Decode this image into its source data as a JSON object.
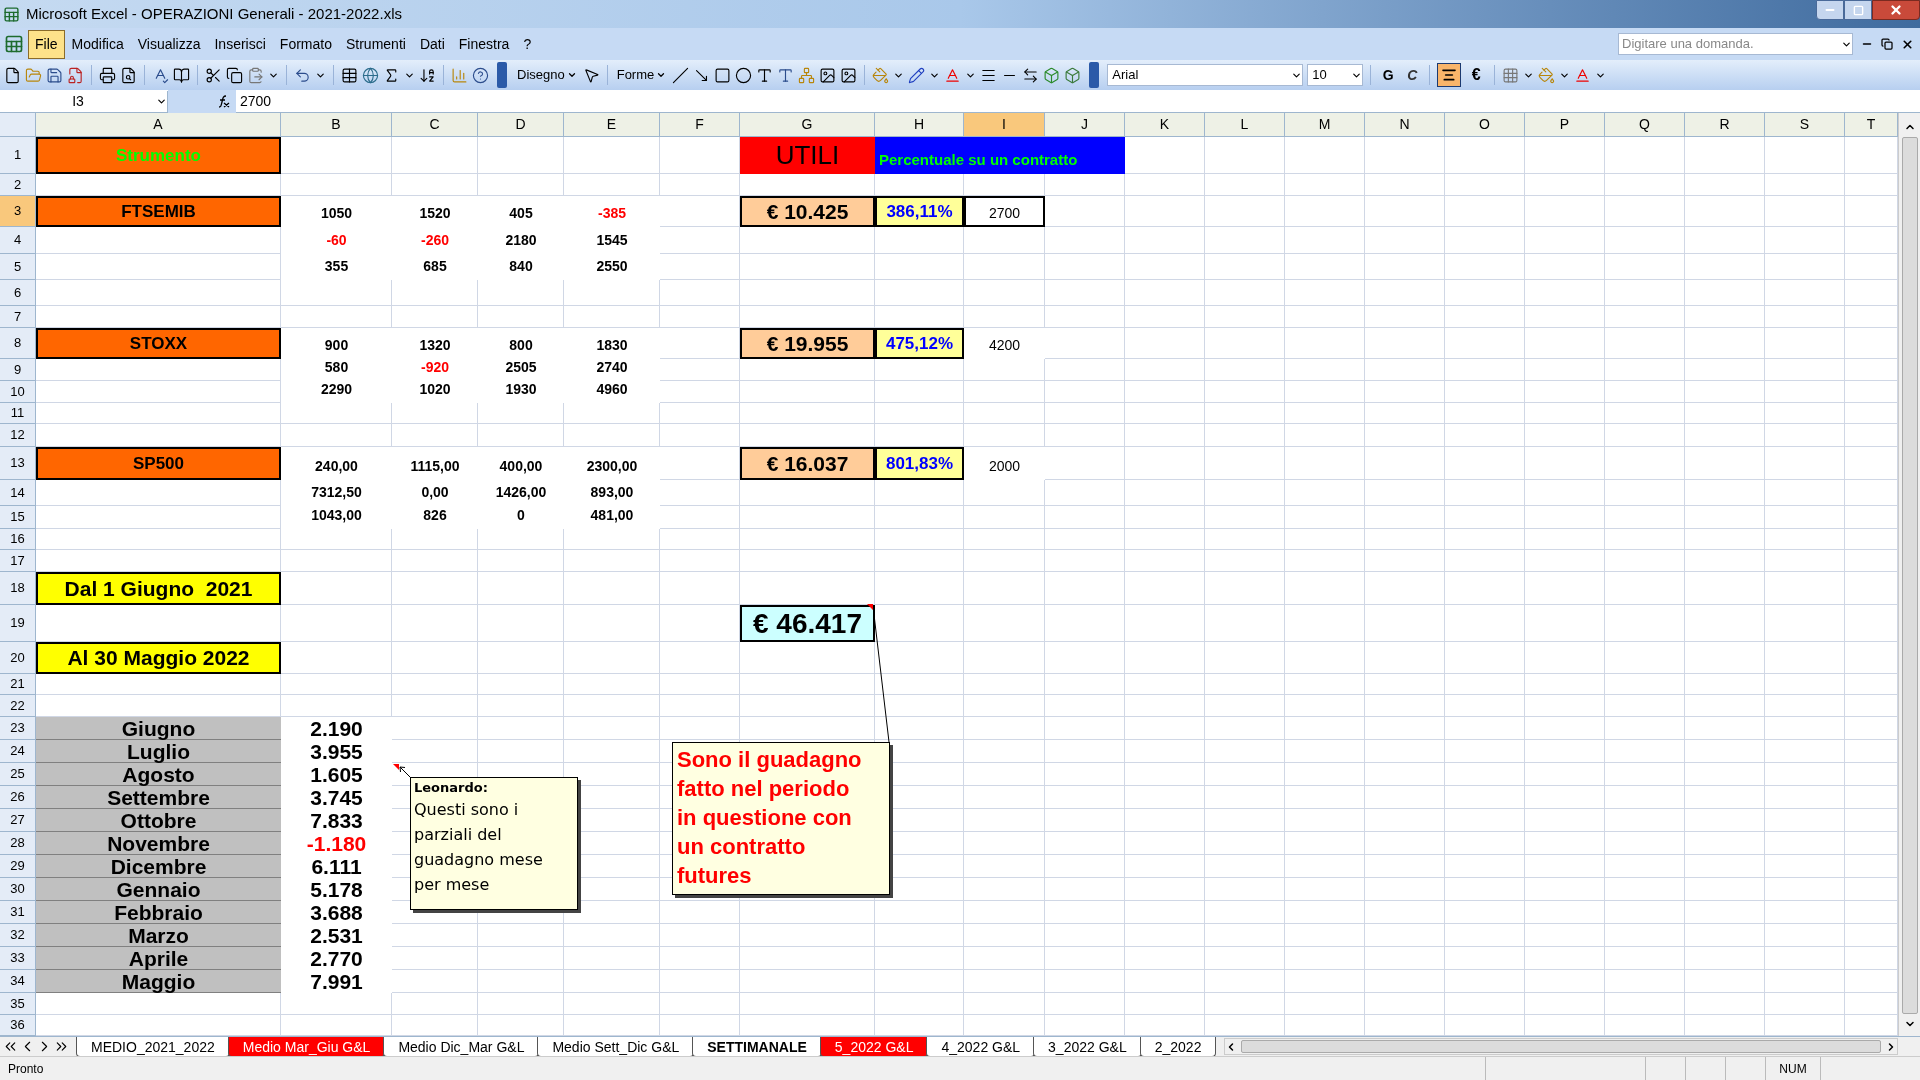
{
  "window": {
    "title": "Microsoft Excel - OPERAZIONI Generali - 2021-2022.xls"
  },
  "menu": [
    {
      "label": "File",
      "selected": true
    },
    {
      "label": "Modifica",
      "selected": false
    },
    {
      "label": "Visualizza",
      "selected": false
    },
    {
      "label": "Inserisci",
      "selected": false
    },
    {
      "label": "Formato",
      "selected": false
    },
    {
      "label": "Strumenti",
      "selected": false
    },
    {
      "label": "Dati",
      "selected": false
    },
    {
      "label": "Finestra",
      "selected": false
    },
    {
      "label": "?",
      "selected": false
    }
  ],
  "help_search": {
    "placeholder": "Digitare una domanda."
  },
  "toolbar": {
    "drawing_menu": "Disegno",
    "shapes_menu": "Forme",
    "font": "Arial",
    "font_size": "10",
    "bold": "G",
    "italic": "C",
    "euro": "€",
    "center_aligned": true
  },
  "formula_bar": {
    "name_box": "I3",
    "value": "2700"
  },
  "columns": [
    {
      "label": "A",
      "selected": false
    },
    {
      "label": "B",
      "selected": false
    },
    {
      "label": "C",
      "selected": false
    },
    {
      "label": "D",
      "selected": false
    },
    {
      "label": "E",
      "selected": false
    },
    {
      "label": "F",
      "selected": false
    },
    {
      "label": "G",
      "selected": false
    },
    {
      "label": "H",
      "selected": false
    },
    {
      "label": "I",
      "selected": true
    },
    {
      "label": "J",
      "selected": false
    },
    {
      "label": "K",
      "selected": false
    },
    {
      "label": "L",
      "selected": false
    },
    {
      "label": "M",
      "selected": false
    },
    {
      "label": "N",
      "selected": false
    },
    {
      "label": "O",
      "selected": false
    },
    {
      "label": "P",
      "selected": false
    },
    {
      "label": "Q",
      "selected": false
    },
    {
      "label": "R",
      "selected": false
    },
    {
      "label": "S",
      "selected": false
    },
    {
      "label": "T",
      "selected": false
    }
  ],
  "rows": [
    {
      "number": "1",
      "selected": false,
      "cells": [
        {
          "kind": "header",
          "text": "Strumento"
        },
        {
          "kind": "blank"
        },
        {
          "kind": "blank"
        },
        {
          "kind": "blank"
        },
        {
          "kind": "blank"
        },
        {
          "kind": "blank"
        },
        {
          "kind": "utili",
          "text": "UTILI"
        },
        {
          "kind": "percent-header",
          "text": "Percentuale su un contratto"
        }
      ]
    },
    {
      "number": "2",
      "selected": false
    },
    {
      "number": "3",
      "selected": true,
      "cells": [
        {
          "kind": "instrument",
          "text": "FTSEMIB"
        },
        {
          "kind": "value",
          "text": "1050"
        },
        {
          "kind": "value",
          "text": "1520"
        },
        {
          "kind": "value",
          "text": "405"
        },
        {
          "kind": "negative",
          "text": "-385"
        },
        {
          "kind": "blank"
        },
        {
          "kind": "total",
          "text": "€ 10.425"
        },
        {
          "kind": "percent",
          "text": "386,11%"
        },
        {
          "kind": "plain",
          "text": "2700"
        }
      ]
    },
    {
      "number": "4",
      "selected": false,
      "cells": [
        {
          "kind": "blank"
        },
        {
          "kind": "negative",
          "text": "-60"
        },
        {
          "kind": "negative",
          "text": "-260"
        },
        {
          "kind": "value",
          "text": "2180"
        },
        {
          "kind": "value",
          "text": "1545"
        }
      ]
    },
    {
      "number": "5",
      "selected": false,
      "cells": [
        {
          "kind": "blank"
        },
        {
          "kind": "value",
          "text": "355"
        },
        {
          "kind": "value",
          "text": "685"
        },
        {
          "kind": "value",
          "text": "840"
        },
        {
          "kind": "value",
          "text": "2550"
        }
      ]
    },
    {
      "number": "6",
      "selected": false
    },
    {
      "number": "7",
      "selected": false
    },
    {
      "number": "8",
      "selected": false,
      "cells": [
        {
          "kind": "instrument",
          "text": "STOXX"
        },
        {
          "kind": "value",
          "text": "900"
        },
        {
          "kind": "value",
          "text": "1320"
        },
        {
          "kind": "value",
          "text": "800"
        },
        {
          "kind": "value",
          "text": "1830"
        },
        {
          "kind": "blank"
        },
        {
          "kind": "total",
          "text": "€ 19.955"
        },
        {
          "kind": "percent",
          "text": "475,12%"
        },
        {
          "kind": "plain",
          "text": "4200"
        }
      ]
    },
    {
      "number": "9",
      "selected": false,
      "cells": [
        {
          "kind": "blank"
        },
        {
          "kind": "value",
          "text": "580"
        },
        {
          "kind": "negative",
          "text": "-920"
        },
        {
          "kind": "value",
          "text": "2505"
        },
        {
          "kind": "value",
          "text": "2740"
        }
      ]
    },
    {
      "number": "10",
      "selected": false,
      "cells": [
        {
          "kind": "blank"
        },
        {
          "kind": "value",
          "text": "2290"
        },
        {
          "kind": "value",
          "text": "1020"
        },
        {
          "kind": "value",
          "text": "1930"
        },
        {
          "kind": "value",
          "text": "4960"
        }
      ]
    },
    {
      "number": "11",
      "selected": false
    },
    {
      "number": "12",
      "selected": false
    },
    {
      "number": "13",
      "selected": false,
      "cells": [
        {
          "kind": "instrument",
          "text": "SP500"
        },
        {
          "kind": "value",
          "text": "240,00"
        },
        {
          "kind": "value",
          "text": "1115,00"
        },
        {
          "kind": "value",
          "text": "400,00"
        },
        {
          "kind": "value",
          "text": "2300,00"
        },
        {
          "kind": "blank"
        },
        {
          "kind": "total",
          "text": "€ 16.037"
        },
        {
          "kind": "percent",
          "text": "801,83%"
        },
        {
          "kind": "plain",
          "text": "2000"
        }
      ]
    },
    {
      "number": "14",
      "selected": false,
      "cells": [
        {
          "kind": "blank"
        },
        {
          "kind": "value",
          "text": "7312,50"
        },
        {
          "kind": "value",
          "text": "0,00"
        },
        {
          "kind": "value",
          "text": "1426,00"
        },
        {
          "kind": "value",
          "text": "893,00"
        }
      ]
    },
    {
      "number": "15",
      "selected": false,
      "cells": [
        {
          "kind": "blank"
        },
        {
          "kind": "value",
          "text": "1043,00"
        },
        {
          "kind": "value",
          "text": "826"
        },
        {
          "kind": "value",
          "text": "0"
        },
        {
          "kind": "value",
          "text": "481,00"
        }
      ]
    },
    {
      "number": "16",
      "selected": false
    },
    {
      "number": "17",
      "selected": false
    },
    {
      "number": "18",
      "selected": false,
      "cells": [
        {
          "kind": "date",
          "text": "Dal 1 Giugno  2021"
        }
      ]
    },
    {
      "number": "19",
      "selected": false,
      "cells": [
        {
          "kind": "blank"
        },
        {
          "kind": "blank"
        },
        {
          "kind": "blank"
        },
        {
          "kind": "blank"
        },
        {
          "kind": "blank"
        },
        {
          "kind": "blank"
        },
        {
          "kind": "grand-total",
          "text": "€ 46.417"
        }
      ]
    },
    {
      "number": "20",
      "selected": false,
      "cells": [
        {
          "kind": "date",
          "text": "Al 30 Maggio 2022"
        }
      ]
    },
    {
      "number": "21",
      "selected": false
    },
    {
      "number": "22",
      "selected": false
    },
    {
      "number": "23",
      "selected": false,
      "cells": [
        {
          "kind": "month",
          "text": "Giugno"
        },
        {
          "kind": "month-value",
          "text": "2.190"
        }
      ]
    },
    {
      "number": "24",
      "selected": false,
      "cells": [
        {
          "kind": "month",
          "text": "Luglio"
        },
        {
          "kind": "month-value",
          "text": "3.955"
        }
      ]
    },
    {
      "number": "25",
      "selected": false,
      "cells": [
        {
          "kind": "month",
          "text": "Agosto"
        },
        {
          "kind": "month-value",
          "text": "1.605"
        }
      ]
    },
    {
      "number": "26",
      "selected": false,
      "cells": [
        {
          "kind": "month",
          "text": "Settembre"
        },
        {
          "kind": "month-value",
          "text": "3.745"
        }
      ]
    },
    {
      "number": "27",
      "selected": false,
      "cells": [
        {
          "kind": "month",
          "text": "Ottobre"
        },
        {
          "kind": "month-value",
          "text": "7.833"
        }
      ]
    },
    {
      "number": "28",
      "selected": false,
      "cells": [
        {
          "kind": "month",
          "text": "Novembre"
        },
        {
          "kind": "month-negative",
          "text": "-1.180"
        }
      ]
    },
    {
      "number": "29",
      "selected": false,
      "cells": [
        {
          "kind": "month",
          "text": "Dicembre"
        },
        {
          "kind": "month-value",
          "text": "6.111"
        }
      ]
    },
    {
      "number": "30",
      "selected": false,
      "cells": [
        {
          "kind": "month",
          "text": "Gennaio"
        },
        {
          "kind": "month-value",
          "text": "5.178"
        }
      ]
    },
    {
      "number": "31",
      "selected": false,
      "cells": [
        {
          "kind": "month",
          "text": "Febbraio"
        },
        {
          "kind": "month-value",
          "text": "3.688"
        }
      ]
    },
    {
      "number": "32",
      "selected": false,
      "cells": [
        {
          "kind": "month",
          "text": "Marzo"
        },
        {
          "kind": "month-value",
          "text": "2.531"
        }
      ]
    },
    {
      "number": "33",
      "selected": false,
      "cells": [
        {
          "kind": "month",
          "text": "Aprile"
        },
        {
          "kind": "month-value",
          "text": "2.770"
        }
      ]
    },
    {
      "number": "34",
      "selected": false,
      "cells": [
        {
          "kind": "month",
          "text": "Maggio"
        },
        {
          "kind": "month-value",
          "text": "7.991"
        }
      ]
    },
    {
      "number": "35",
      "selected": false
    },
    {
      "number": "36",
      "selected": false
    }
  ],
  "comments": [
    {
      "kind": "note",
      "author": "Leonardo:",
      "text": "Questi sono i parziali del guadagno mese per mese"
    },
    {
      "kind": "callout",
      "text": "Sono il guadagno fatto nel periodo in questione con un contratto futures"
    }
  ],
  "sheet_tabs": [
    {
      "label": "MEDIO_2021_2022",
      "selected": false,
      "color": "#ffffff"
    },
    {
      "label": "Medio Mar_Giu G&L",
      "selected": false,
      "color": "#ff0000"
    },
    {
      "label": "Medio Dic_Mar G&L",
      "selected": false,
      "color": "#ffffff"
    },
    {
      "label": "Medio Sett_Dic G&L",
      "selected": false,
      "color": "#ffffff"
    },
    {
      "label": "SETTIMANALE",
      "selected": true,
      "color": "#ffffff"
    },
    {
      "label": "5_2022 G&L",
      "selected": false,
      "color": "#ff0000"
    },
    {
      "label": "4_2022 G&L",
      "selected": false,
      "color": "#ffffff"
    },
    {
      "label": "3_2022 G&L",
      "selected": false,
      "color": "#ffffff"
    },
    {
      "label": "2_2022",
      "selected": false,
      "color": "#ffffff"
    }
  ],
  "status_bar": {
    "mode": "Pronto",
    "num_lock": "NUM"
  }
}
